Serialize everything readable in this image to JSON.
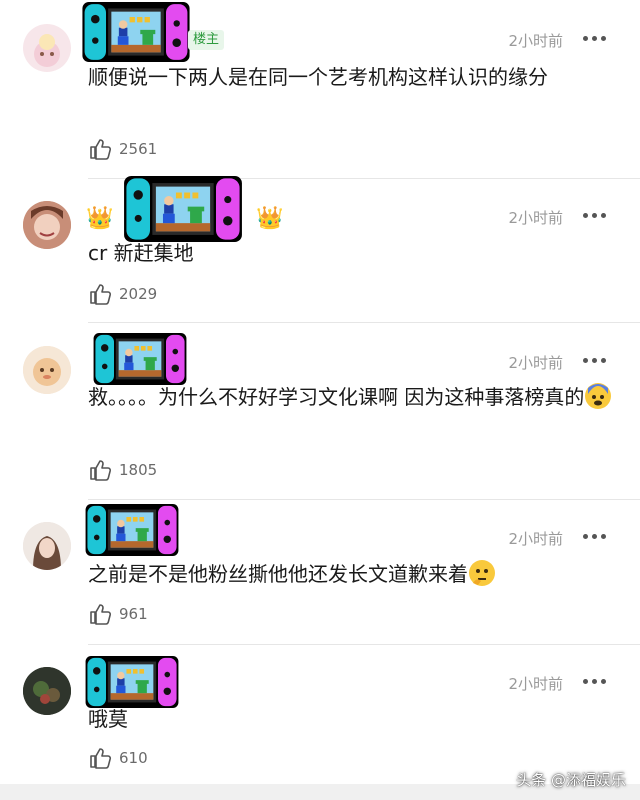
{
  "comments": [
    {
      "username_prefix": "",
      "badge": "楼主",
      "time": "2小时前",
      "text": "顺便说一下两人是在同一个艺考机构这样认识的缘分",
      "likes": "2561"
    },
    {
      "username_prefix": "",
      "time": "2小时前",
      "text": "cr 新赶集地",
      "likes": "2029"
    },
    {
      "username_prefix": "",
      "time": "2小时前",
      "text": "救。。。。为什么不好好学习文化课啊  因为这种事落榜真的",
      "likes": "1805"
    },
    {
      "username_prefix": "",
      "time": "2小时前",
      "text": "之前是不是他粉丝撕他他还发长文道歉来着",
      "likes": "961"
    },
    {
      "username_prefix": "",
      "time": "2小时前",
      "text": "哦莫",
      "likes": "610"
    }
  ],
  "watermark": "头条 @添福娱乐",
  "colors": {
    "switch_left": "#1ec5d6",
    "switch_right": "#e34bf0",
    "badge_green": "#2e9b3f"
  }
}
